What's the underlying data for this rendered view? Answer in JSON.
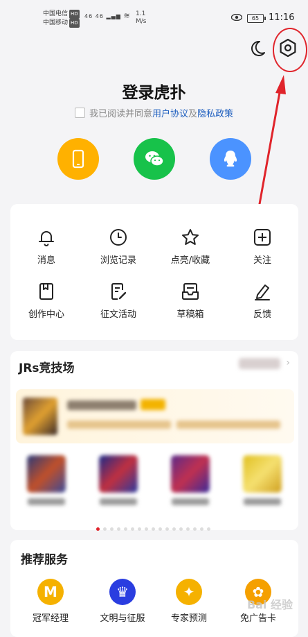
{
  "status_bar": {
    "carrier_line1": "中国电信",
    "carrier_line2": "中国移动",
    "hd_badge": "HD",
    "network": "46 46",
    "speed_value": "1.1",
    "speed_unit": "M/s",
    "battery": "65",
    "time": "11:16"
  },
  "header": {
    "moon_icon": "moon-icon",
    "settings_icon": "hexagon-gear-icon"
  },
  "login": {
    "title": "登录虎扑",
    "agree_text": "我已阅读并同意",
    "user_agreement": "用户协议",
    "and": "及",
    "privacy_policy": "隐私政策",
    "methods": [
      "phone-icon",
      "wechat-icon",
      "qq-icon"
    ]
  },
  "menu": {
    "items": [
      {
        "label": "消息",
        "icon": "bell-icon"
      },
      {
        "label": "浏览记录",
        "icon": "clock-icon"
      },
      {
        "label": "点亮/收藏",
        "icon": "star-icon"
      },
      {
        "label": "关注",
        "icon": "plus-square-icon"
      },
      {
        "label": "创作中心",
        "icon": "bookmark-icon"
      },
      {
        "label": "征文活动",
        "icon": "edit-doc-icon"
      },
      {
        "label": "草稿箱",
        "icon": "inbox-icon"
      },
      {
        "label": "反馈",
        "icon": "pencil-icon"
      }
    ]
  },
  "arena": {
    "title": "JRs竞技场",
    "more_arrow": "›",
    "page_count": 17,
    "active_page": 1
  },
  "services": {
    "title": "推荐服务",
    "items": [
      {
        "label": "冠军经理",
        "icon_text": "M",
        "color": "#f5b100"
      },
      {
        "label": "文明与征服",
        "icon_text": "♛",
        "color": "#2a3de0"
      },
      {
        "label": "专家预测",
        "icon_text": "✦",
        "color": "#f5b100"
      },
      {
        "label": "免广告卡",
        "icon_text": "✿",
        "color": "#f5a000"
      }
    ]
  },
  "watermark": "Bai 经验",
  "colors": {
    "annotation_red": "#e0242b",
    "link_blue": "#1f5fbf"
  }
}
